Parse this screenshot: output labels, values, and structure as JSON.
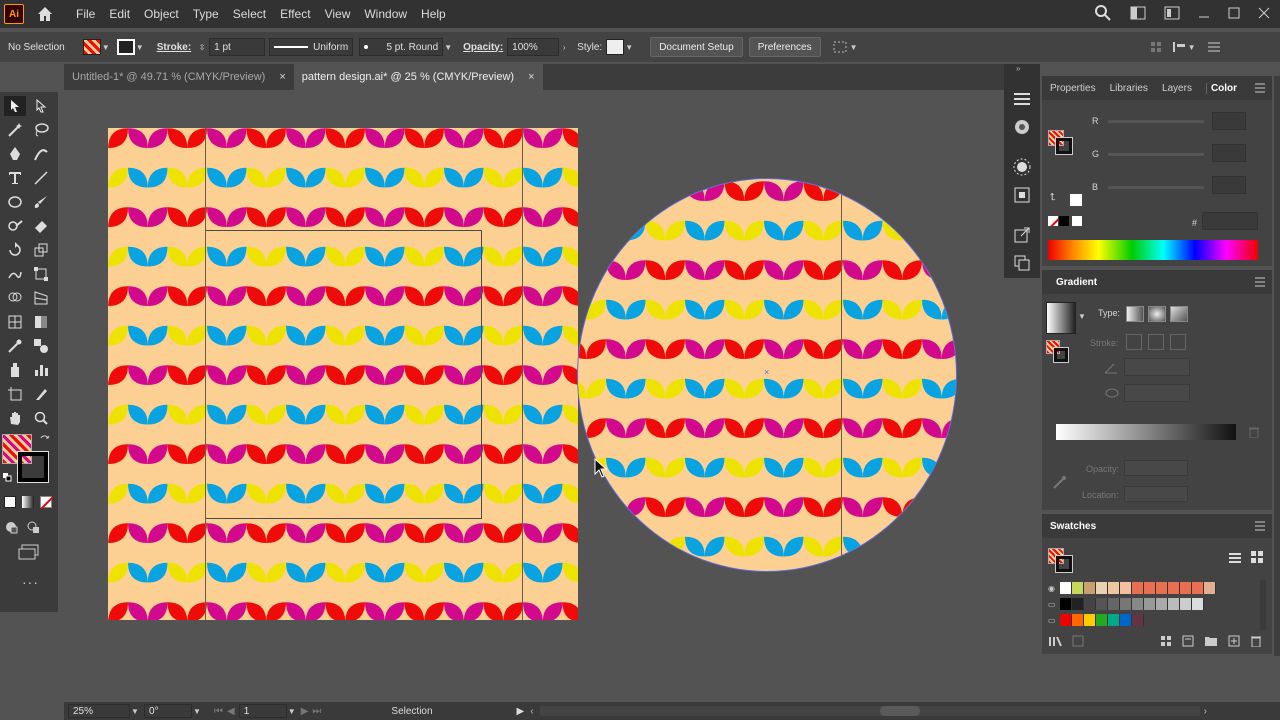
{
  "app": {
    "logo_text": "Ai"
  },
  "menu": [
    "File",
    "Edit",
    "Object",
    "Type",
    "Select",
    "Effect",
    "View",
    "Window",
    "Help"
  ],
  "control": {
    "selection": "No Selection",
    "stroke_label": "Stroke:",
    "stroke_value": "1 pt",
    "stroke_profile": "Uniform",
    "brush": "5 pt. Round",
    "opacity_label": "Opacity:",
    "opacity_value": "100%",
    "style_label": "Style:",
    "document_setup": "Document Setup",
    "preferences": "Preferences"
  },
  "tabs": [
    {
      "label": "Untitled-1* @ 49.71 % (CMYK/Preview)",
      "close": "×"
    },
    {
      "label": "pattern design.ai* @ 25 % (CMYK/Preview)",
      "close": "×"
    }
  ],
  "panel_tabs": [
    "Properties",
    "Libraries",
    "Layers",
    "Color"
  ],
  "color_panel": {
    "r": "R",
    "g": "G",
    "b": "B",
    "hash": "#"
  },
  "gradient": {
    "title": "Gradient",
    "type_label": "Type:",
    "stroke_label": "Stroke:",
    "opacity_label": "Opacity:",
    "location_label": "Location:"
  },
  "swatches": {
    "title": "Swatches"
  },
  "status": {
    "zoom": "25%",
    "rotation": "0°",
    "artboard": "1",
    "mode": "Selection"
  },
  "colors": {
    "red": "#f00b0b",
    "magenta": "#d2098c",
    "yellow": "#eee300",
    "cyan": "#08a3e0",
    "bg": "#fccf92"
  }
}
